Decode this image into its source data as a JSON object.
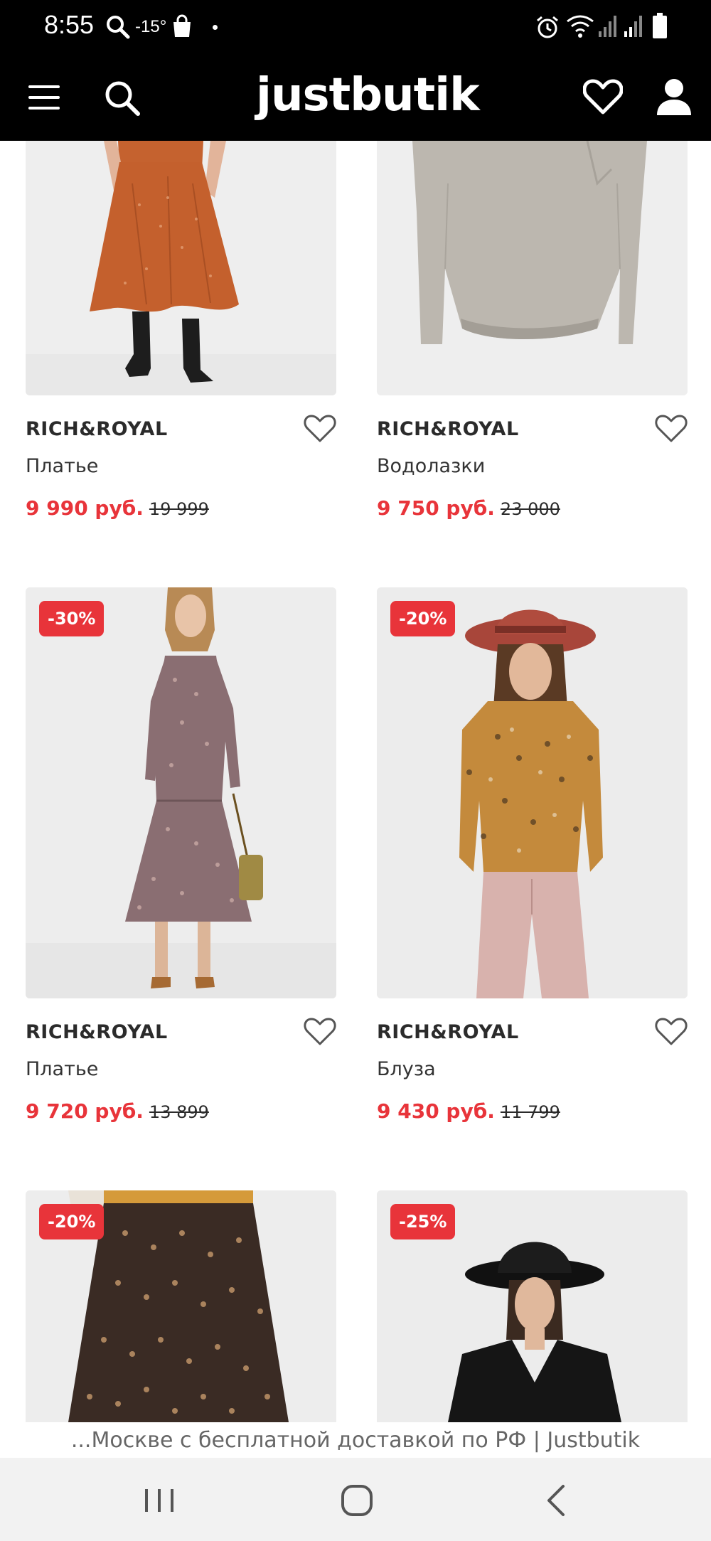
{
  "status_bar": {
    "time": "8:55",
    "temperature": "-15°"
  },
  "header": {
    "logo": "justbutik"
  },
  "products": [
    {
      "brand": "RICH&ROYAL",
      "type": "Платье",
      "price": "9 990 руб.",
      "old_price": "19 999",
      "badge": ""
    },
    {
      "brand": "RICH&ROYAL",
      "type": "Водолазки",
      "price": "9 750 руб.",
      "old_price": "23 000",
      "badge": ""
    },
    {
      "brand": "RICH&ROYAL",
      "type": "Платье",
      "price": "9 720 руб.",
      "old_price": "13 899",
      "badge": "-30%"
    },
    {
      "brand": "RICH&ROYAL",
      "type": "Блуза",
      "price": "9 430 руб.",
      "old_price": "11 799",
      "badge": "-20%"
    },
    {
      "brand": "",
      "type": "",
      "price": "",
      "old_price": "",
      "badge": "-20%"
    },
    {
      "brand": "",
      "type": "",
      "price": "",
      "old_price": "",
      "badge": "-25%"
    }
  ],
  "footer": {
    "page_title": "...Москве с бесплатной доставкой по РФ | Justbutik"
  },
  "colors": {
    "accent": "#e8343a",
    "header_bg": "#000000"
  }
}
